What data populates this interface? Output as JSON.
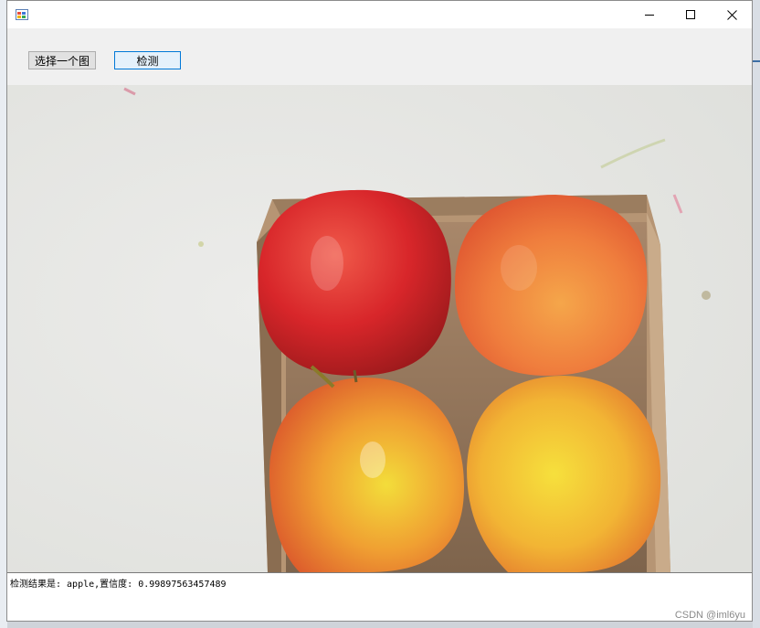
{
  "window": {
    "title": "",
    "controls": {
      "minimize_icon": "minimize-icon",
      "maximize_icon": "maximize-icon",
      "close_icon": "close-icon"
    }
  },
  "toolbar": {
    "select_label": "选择一个图",
    "detect_label": "检测"
  },
  "image": {
    "subject": "four-apples-in-cardboard-box"
  },
  "result": {
    "text": "检测结果是: apple,置信度: 0.99897563457489"
  },
  "watermark": "CSDN @iml6yu"
}
